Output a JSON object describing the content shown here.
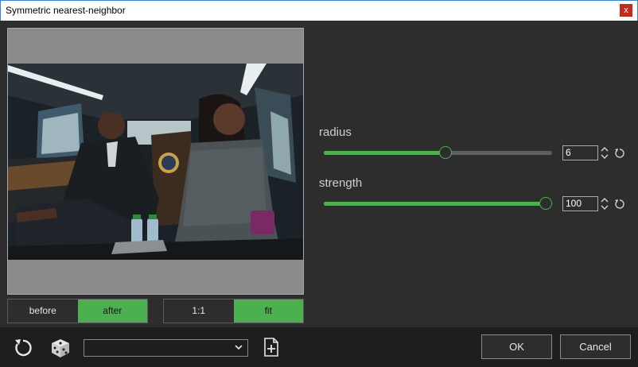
{
  "window": {
    "title": "Symmetric nearest-neighbor",
    "close_glyph": "x"
  },
  "view_toggle": {
    "before_label": "before",
    "after_label": "after",
    "active": "after"
  },
  "zoom_toggle": {
    "one_to_one_label": "1:1",
    "fit_label": "fit",
    "active": "fit"
  },
  "params": [
    {
      "label": "radius",
      "value": "6",
      "level": 0.55
    },
    {
      "label": "strength",
      "value": "100",
      "level": 1.0
    }
  ],
  "bottom": {
    "preset_value": "",
    "ok_label": "OK",
    "cancel_label": "Cancel"
  },
  "colors": {
    "accent": "#4caf50",
    "background": "#2d2d2d",
    "toolbar": "#1e1e1e"
  }
}
